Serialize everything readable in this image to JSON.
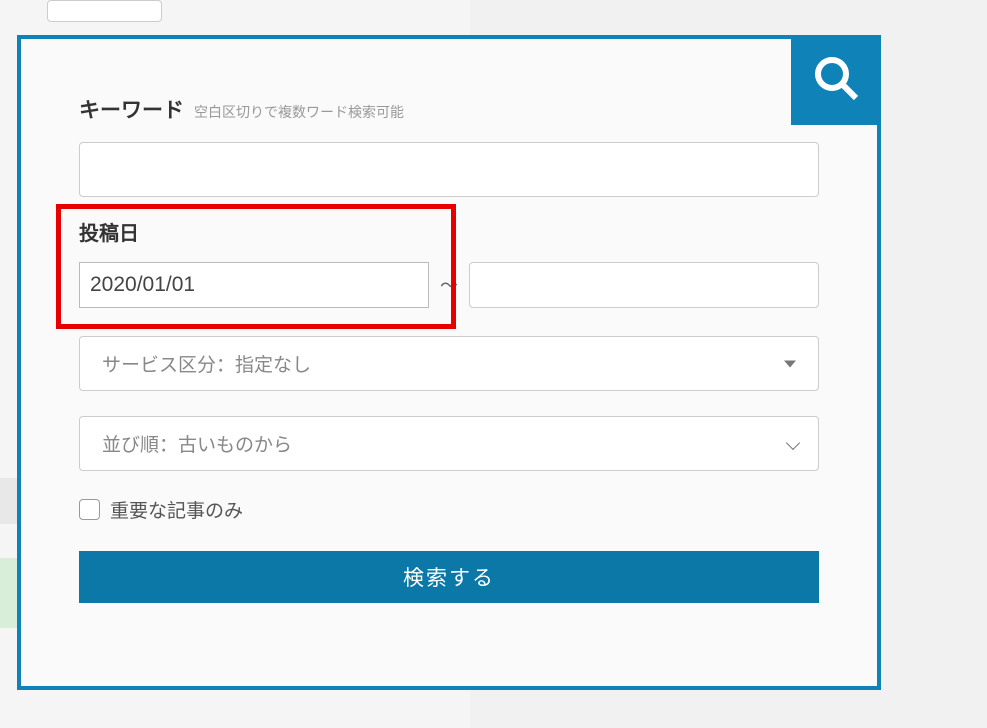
{
  "colors": {
    "accent": "#0f83b8",
    "highlight": "#e60000",
    "button": "#0c78a8"
  },
  "keyword": {
    "label": "キーワード",
    "hint": "空白区切りで複数ワード検索可能",
    "value": ""
  },
  "post_date": {
    "label": "投稿日",
    "from": "2020/01/01",
    "separator": "～",
    "to": ""
  },
  "service_select": {
    "text": "サービス区分：指定なし"
  },
  "sort_select": {
    "text": "並び順：古いものから"
  },
  "important_only": {
    "label": "重要な記事のみ",
    "checked": false
  },
  "submit": {
    "label": "検索する"
  }
}
